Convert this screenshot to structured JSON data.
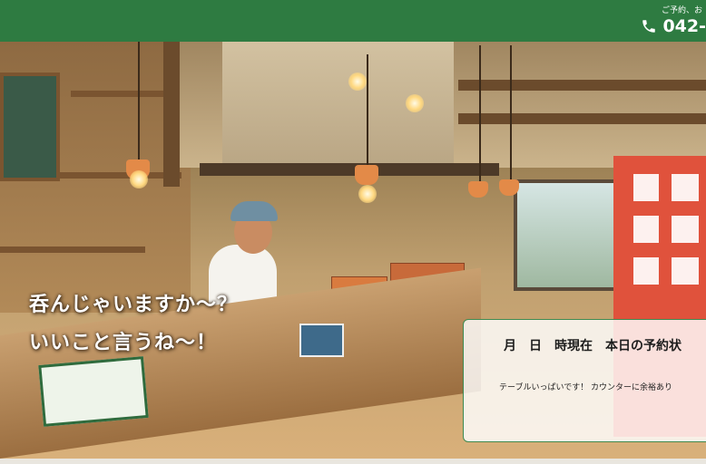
{
  "header": {
    "note": "ご予約、お",
    "phone": "042-",
    "accent_color": "#2e7b41",
    "phone_icon": "phone-icon"
  },
  "hero": {
    "tagline_line1": "呑んじゃいますか〜？",
    "tagline_line2": "いいこと言うね〜！"
  },
  "status_card": {
    "title": "月　日　時現在　本日の予約状",
    "message": "テーブルいっぱいです！ カウンターに余裕あり"
  }
}
